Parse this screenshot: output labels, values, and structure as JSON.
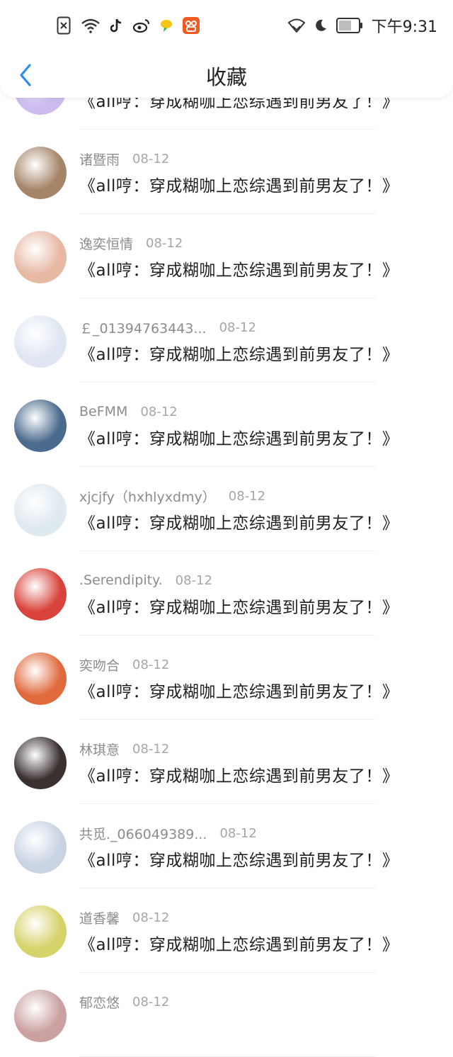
{
  "status_bar": {
    "time": "下午9:31",
    "left_icons": [
      "sim-off-icon",
      "wifi-icon",
      "tiktok-icon",
      "weibo-icon",
      "chat-bubble-icon",
      "app-badge-icon"
    ],
    "right_icons": [
      "wifi-signal-icon",
      "moon-icon",
      "battery-icon"
    ]
  },
  "header": {
    "title": "收藏",
    "back_icon": "chevron-left-icon",
    "accent": "#2a8df5"
  },
  "items": [
    {
      "user": "",
      "date": "",
      "title": "《all哼：穿成糊咖上恋综遇到前男友了！》",
      "avatar": "#cdbcf0"
    },
    {
      "user": "诸暨雨",
      "date": "08-12",
      "title": "《all哼：穿成糊咖上恋综遇到前男友了！》",
      "avatar": "#a58467"
    },
    {
      "user": "逸奕恒情",
      "date": "08-12",
      "title": "《all哼：穿成糊咖上恋综遇到前男友了！》",
      "avatar": "#e7b8a4"
    },
    {
      "user": "￡_01394763443...",
      "date": "08-12",
      "title": "《all哼：穿成糊咖上恋综遇到前男友了！》",
      "avatar": "#dfe6f2"
    },
    {
      "user": "BeFMM",
      "date": "08-12",
      "title": "《all哼：穿成糊咖上恋综遇到前男友了！》",
      "avatar": "#4a6a8e"
    },
    {
      "user": "xjcjfy（hxhlyxdmy）",
      "date": "08-12",
      "title": "《all哼：穿成糊咖上恋综遇到前男友了！》",
      "avatar": "#dfe9f0"
    },
    {
      "user": ".Serendipity.",
      "date": "08-12",
      "title": "《all哼：穿成糊咖上恋综遇到前男友了！》",
      "avatar": "#d9433b"
    },
    {
      "user": "奕吻合",
      "date": "08-12",
      "title": "《all哼：穿成糊咖上恋综遇到前男友了！》",
      "avatar": "#e06a3c"
    },
    {
      "user": "林琪意",
      "date": "08-12",
      "title": "《all哼：穿成糊咖上恋综遇到前男友了！》",
      "avatar": "#3a3030"
    },
    {
      "user": "共觅._066049389...",
      "date": "08-12",
      "title": "《all哼：穿成糊咖上恋综遇到前男友了！》",
      "avatar": "#c9d4e3"
    },
    {
      "user": "道香馨",
      "date": "08-12",
      "title": "《all哼：穿成糊咖上恋综遇到前男友了！》",
      "avatar": "#d6d36a"
    },
    {
      "user": "郁恋悠",
      "date": "08-12",
      "title": "",
      "avatar": "#caa0a0"
    }
  ]
}
